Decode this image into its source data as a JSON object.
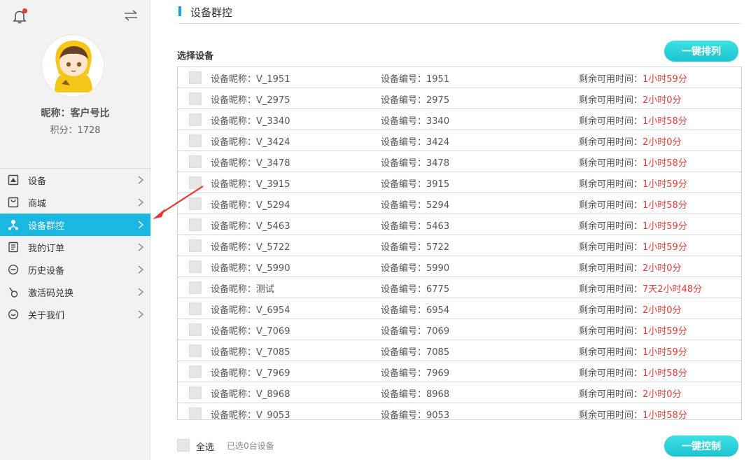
{
  "sidebar": {
    "nickname": "昵称：客户号比",
    "points": "积分：1728",
    "items": [
      {
        "label": "设备",
        "icon": "device-icon"
      },
      {
        "label": "商城",
        "icon": "mall-icon"
      },
      {
        "label": "设备群控",
        "icon": "group-control-icon"
      },
      {
        "label": "我的订单",
        "icon": "orders-icon"
      },
      {
        "label": "历史设备",
        "icon": "history-icon"
      },
      {
        "label": "激活码兑换",
        "icon": "redeem-icon"
      },
      {
        "label": "关于我们",
        "icon": "about-icon"
      }
    ],
    "active_index": 2
  },
  "main": {
    "title": "设备群控",
    "section_label": "选择设备",
    "arrange_button": "一键排列",
    "control_button": "一键控制",
    "select_all": "全选",
    "selected_count": "已选0台设备",
    "rows": [
      {
        "nick": "设备昵称：V_1951",
        "num": "设备编号：1951",
        "rem_label": "剩余可用时间：",
        "rem": "1小时59分"
      },
      {
        "nick": "设备昵称：V_2975",
        "num": "设备编号：2975",
        "rem_label": "剩余可用时间：",
        "rem": "2小时0分"
      },
      {
        "nick": "设备昵称：V_3340",
        "num": "设备编号：3340",
        "rem_label": "剩余可用时间：",
        "rem": "1小时58分"
      },
      {
        "nick": "设备昵称：V_3424",
        "num": "设备编号：3424",
        "rem_label": "剩余可用时间：",
        "rem": "2小时0分"
      },
      {
        "nick": "设备昵称：V_3478",
        "num": "设备编号：3478",
        "rem_label": "剩余可用时间：",
        "rem": "1小时58分"
      },
      {
        "nick": "设备昵称：V_3915",
        "num": "设备编号：3915",
        "rem_label": "剩余可用时间：",
        "rem": "1小时59分"
      },
      {
        "nick": "设备昵称：V_5294",
        "num": "设备编号：5294",
        "rem_label": "剩余可用时间：",
        "rem": "1小时58分"
      },
      {
        "nick": "设备昵称：V_5463",
        "num": "设备编号：5463",
        "rem_label": "剩余可用时间：",
        "rem": "1小时59分"
      },
      {
        "nick": "设备昵称：V_5722",
        "num": "设备编号：5722",
        "rem_label": "剩余可用时间：",
        "rem": "1小时59分"
      },
      {
        "nick": "设备昵称：V_5990",
        "num": "设备编号：5990",
        "rem_label": "剩余可用时间：",
        "rem": "2小时0分"
      },
      {
        "nick": "设备昵称：测试",
        "num": "设备编号：6775",
        "rem_label": "剩余可用时间：",
        "rem": "7天2小时48分"
      },
      {
        "nick": "设备昵称：V_6954",
        "num": "设备编号：6954",
        "rem_label": "剩余可用时间：",
        "rem": "2小时0分"
      },
      {
        "nick": "设备昵称：V_7069",
        "num": "设备编号：7069",
        "rem_label": "剩余可用时间：",
        "rem": "1小时59分"
      },
      {
        "nick": "设备昵称：V_7085",
        "num": "设备编号：7085",
        "rem_label": "剩余可用时间：",
        "rem": "1小时59分"
      },
      {
        "nick": "设备昵称：V_7969",
        "num": "设备编号：7969",
        "rem_label": "剩余可用时间：",
        "rem": "1小时58分"
      },
      {
        "nick": "设备昵称：V_8968",
        "num": "设备编号：8968",
        "rem_label": "剩余可用时间：",
        "rem": "2小时0分"
      },
      {
        "nick": "设备昵称：V_9053",
        "num": "设备编号：9053",
        "rem_label": "剩余可用时间：",
        "rem": "1小时58分"
      }
    ]
  },
  "colors": {
    "accent": "#1ab7e3",
    "button": "#1cc4cf",
    "remaining_time": "#e53935",
    "annotation_arrow": "#e53935"
  },
  "icons": {
    "bell": "bell-icon",
    "notification_dot": "notification-dot-icon",
    "swap": "swap-arrows-icon",
    "chevron": "chevron-right-icon"
  }
}
